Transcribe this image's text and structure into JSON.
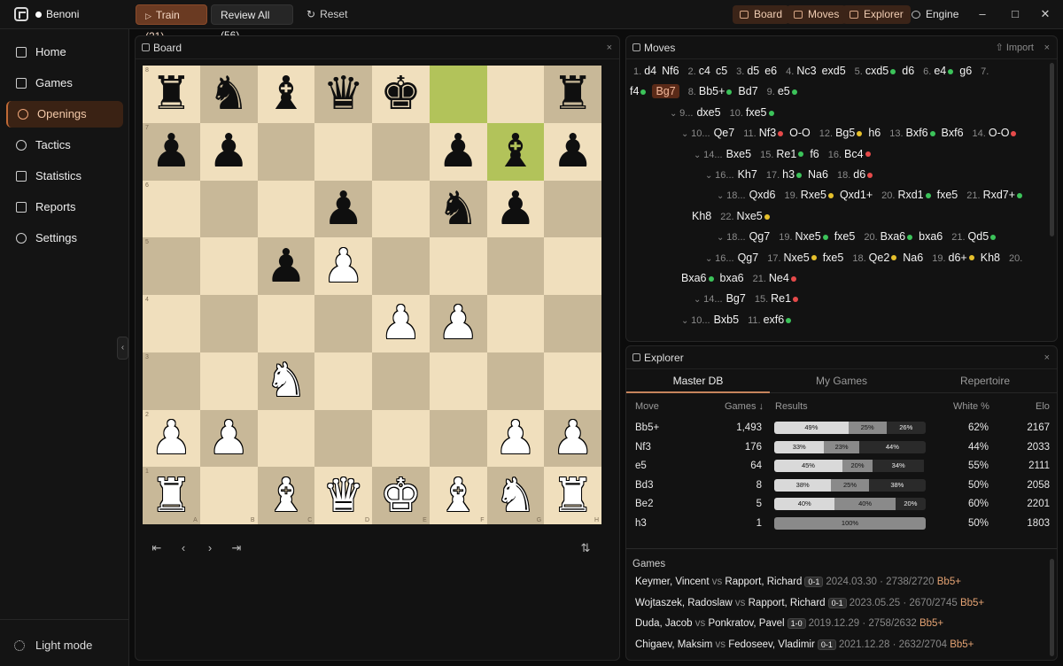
{
  "app": {
    "title": "Benoni"
  },
  "toolbar": {
    "train": "Train (21)",
    "review": "Review All (56)",
    "reset": "Reset"
  },
  "right_tabs": [
    "Board",
    "Moves",
    "Explorer",
    "Engine"
  ],
  "window_controls": [
    "minimize-icon",
    "maximize-icon",
    "close-icon"
  ],
  "sidebar": {
    "items": [
      {
        "label": "Home",
        "icon": "home-icon"
      },
      {
        "label": "Games",
        "icon": "library-icon"
      },
      {
        "label": "Openings",
        "icon": "openings-icon",
        "active": true
      },
      {
        "label": "Tactics",
        "icon": "target-icon"
      },
      {
        "label": "Statistics",
        "icon": "chart-icon"
      },
      {
        "label": "Reports",
        "icon": "report-icon"
      },
      {
        "label": "Settings",
        "icon": "gear-icon"
      }
    ],
    "light_mode": "Light mode"
  },
  "board_panel": {
    "title": "Board",
    "close": "×"
  },
  "board": {
    "files": [
      "A",
      "B",
      "C",
      "D",
      "E",
      "F",
      "G",
      "H"
    ],
    "ranks": [
      "8",
      "7",
      "6",
      "5",
      "4",
      "3",
      "2",
      "1"
    ],
    "highlight": [
      "f8",
      "g7"
    ],
    "pieces": [
      [
        "br",
        "bn",
        "bb",
        "bq",
        "bk",
        "",
        "",
        "br"
      ],
      [
        "bp",
        "bp",
        "",
        "",
        "",
        "bp",
        "bb",
        "bp"
      ],
      [
        "",
        "",
        "",
        "bp",
        "",
        "bn",
        "bp",
        ""
      ],
      [
        "",
        "",
        "bp",
        "wp",
        "",
        "",
        "",
        ""
      ],
      [
        "",
        "",
        "",
        "",
        "wp",
        "wp",
        "",
        ""
      ],
      [
        "",
        "",
        "wn",
        "",
        "",
        "",
        "",
        ""
      ],
      [
        "wp",
        "wp",
        "",
        "",
        "",
        "",
        "wp",
        "wp"
      ],
      [
        "wr",
        "",
        "wb",
        "wq",
        "wk",
        "wb",
        "wn",
        "wr"
      ]
    ]
  },
  "moves_panel": {
    "title": "Moves",
    "import": "Import",
    "lines": [
      {
        "indent": 0,
        "tokens": [
          [
            "1.",
            "n"
          ],
          [
            "d4",
            ""
          ],
          [
            "Nf6",
            ""
          ],
          [
            "2.",
            "n"
          ],
          [
            "c4",
            ""
          ],
          [
            "c5",
            ""
          ],
          [
            "3.",
            "n"
          ],
          [
            "d5",
            ""
          ],
          [
            "e6",
            ""
          ],
          [
            "4.",
            "n"
          ],
          [
            "Nc3",
            ""
          ],
          [
            "exd5",
            ""
          ],
          [
            "5.",
            "n"
          ],
          [
            "cxd5",
            "g"
          ],
          [
            "d6",
            ""
          ],
          [
            "6.",
            "n"
          ],
          [
            "e4",
            "g"
          ],
          [
            "g6",
            ""
          ],
          [
            "7.",
            "n"
          ]
        ]
      },
      {
        "indent": 0,
        "tokens": [
          [
            "f4",
            "g"
          ],
          [
            "Bg7",
            "cur"
          ],
          [
            "8.",
            "n"
          ],
          [
            "Bb5+",
            "g"
          ],
          [
            "Bd7",
            ""
          ],
          [
            "9.",
            "n"
          ],
          [
            "e5",
            "g"
          ]
        ]
      },
      {
        "indent": 1,
        "tokens": [
          [
            "9...",
            "v"
          ],
          [
            "dxe5",
            ""
          ],
          [
            "10.",
            "n"
          ],
          [
            "fxe5",
            "g"
          ]
        ]
      },
      {
        "indent": 2,
        "tokens": [
          [
            "10...",
            "v"
          ],
          [
            "Qe7",
            ""
          ],
          [
            "11.",
            "n"
          ],
          [
            "Nf3",
            "r"
          ],
          [
            "O-O",
            ""
          ],
          [
            "12.",
            "n"
          ],
          [
            "Bg5",
            "y"
          ],
          [
            "h6",
            ""
          ],
          [
            "13.",
            "n"
          ],
          [
            "Bxf6",
            "g"
          ],
          [
            "Bxf6",
            ""
          ],
          [
            "14.",
            "n"
          ],
          [
            "O-O",
            "r"
          ]
        ]
      },
      {
        "indent": 3,
        "tokens": [
          [
            "14...",
            "v"
          ],
          [
            "Bxe5",
            ""
          ],
          [
            "15.",
            "n"
          ],
          [
            "Re1",
            "g"
          ],
          [
            "f6",
            ""
          ],
          [
            "16.",
            "n"
          ],
          [
            "Bc4",
            "r"
          ]
        ]
      },
      {
        "indent": 4,
        "tokens": [
          [
            "16...",
            "v"
          ],
          [
            "Kh7",
            ""
          ],
          [
            "17.",
            "n"
          ],
          [
            "h3",
            "g"
          ],
          [
            "Na6",
            ""
          ],
          [
            "18.",
            "n"
          ],
          [
            "d6",
            "r"
          ]
        ]
      },
      {
        "indent": 5,
        "tokens": [
          [
            "18...",
            "v"
          ],
          [
            "Qxd6",
            ""
          ],
          [
            "19.",
            "n"
          ],
          [
            "Rxe5",
            "y"
          ],
          [
            "Qxd1+",
            ""
          ],
          [
            "20.",
            "n"
          ],
          [
            "Rxd1",
            "g"
          ],
          [
            "fxe5",
            ""
          ],
          [
            "21.",
            "n"
          ],
          [
            "Rxd7+",
            "g"
          ]
        ]
      },
      {
        "indent": 9,
        "tokens": [
          [
            "Kh8",
            ""
          ],
          [
            "22.",
            "n"
          ],
          [
            "Nxe5",
            "y"
          ]
        ]
      },
      {
        "indent": 5,
        "tokens": [
          [
            "18...",
            "v"
          ],
          [
            "Qg7",
            ""
          ],
          [
            "19.",
            "n"
          ],
          [
            "Nxe5",
            "g"
          ],
          [
            "fxe5",
            ""
          ],
          [
            "20.",
            "n"
          ],
          [
            "Bxa6",
            "g"
          ],
          [
            "bxa6",
            ""
          ],
          [
            "21.",
            "n"
          ],
          [
            "Qd5",
            "g"
          ]
        ]
      },
      {
        "indent": 4,
        "tokens": [
          [
            "16...",
            "v"
          ],
          [
            "Qg7",
            ""
          ],
          [
            "17.",
            "n"
          ],
          [
            "Nxe5",
            "y"
          ],
          [
            "fxe5",
            ""
          ],
          [
            "18.",
            "n"
          ],
          [
            "Qe2",
            "y"
          ],
          [
            "Na6",
            ""
          ],
          [
            "19.",
            "n"
          ],
          [
            "d6+",
            "y"
          ],
          [
            "Kh8",
            ""
          ],
          [
            "20.",
            "n"
          ]
        ]
      },
      {
        "indent": 10,
        "tokens": [
          [
            "Bxa6",
            "g"
          ],
          [
            "bxa6",
            ""
          ],
          [
            "21.",
            "n"
          ],
          [
            "Ne4",
            "r"
          ]
        ]
      },
      {
        "indent": 3,
        "tokens": [
          [
            "14...",
            "v"
          ],
          [
            "Bg7",
            ""
          ],
          [
            "15.",
            "n"
          ],
          [
            "Re1",
            "r"
          ]
        ]
      },
      {
        "indent": 2,
        "tokens": [
          [
            "10...",
            "v"
          ],
          [
            "Bxb5",
            ""
          ],
          [
            "11.",
            "n"
          ],
          [
            "exf6",
            "g"
          ]
        ]
      }
    ]
  },
  "explorer_panel": {
    "title": "Explorer",
    "tabs": [
      "Master DB",
      "My Games",
      "Repertoire"
    ],
    "headers": {
      "move": "Move",
      "games": "Games ↓",
      "results": "Results",
      "white": "White %",
      "elo": "Elo"
    },
    "rows": [
      {
        "move": "Bb5+",
        "games": "1,493",
        "w": 49,
        "d": 25,
        "b": 26,
        "wl": "49%",
        "dl": "25%",
        "bl": "26%",
        "white": "62%",
        "elo": "2167"
      },
      {
        "move": "Nf3",
        "games": "176",
        "w": 33,
        "d": 23,
        "b": 44,
        "wl": "33%",
        "dl": "23%",
        "bl": "44%",
        "white": "44%",
        "elo": "2033"
      },
      {
        "move": "e5",
        "games": "64",
        "w": 45,
        "d": 20,
        "b": 34,
        "wl": "45%",
        "dl": "20%",
        "bl": "34%",
        "white": "55%",
        "elo": "2111"
      },
      {
        "move": "Bd3",
        "games": "8",
        "w": 38,
        "d": 25,
        "b": 38,
        "wl": "38%",
        "dl": "25%",
        "bl": "38%",
        "white": "50%",
        "elo": "2058"
      },
      {
        "move": "Be2",
        "games": "5",
        "w": 40,
        "d": 40,
        "b": 20,
        "wl": "40%",
        "dl": "40%",
        "bl": "20%",
        "white": "60%",
        "elo": "2201"
      },
      {
        "move": "h3",
        "games": "1",
        "w": 0,
        "d": 100,
        "b": 0,
        "wl": "",
        "dl": "100%",
        "bl": "",
        "white": "50%",
        "elo": "1803"
      }
    ],
    "games_title": "Games",
    "games": [
      {
        "white": "Keymer, Vincent",
        "black": "Rapport, Richard",
        "result": "0-1",
        "date": "2024.03.30",
        "elo": "2738/2720",
        "move": "Bb5+"
      },
      {
        "white": "Wojtaszek, Radoslaw",
        "black": "Rapport, Richard",
        "result": "0-1",
        "date": "2023.05.25",
        "elo": "2670/2745",
        "move": "Bb5+"
      },
      {
        "white": "Duda, Jacob",
        "black": "Ponkratov, Pavel",
        "result": "1-0",
        "date": "2019.12.29",
        "elo": "2758/2632",
        "move": "Bb5+"
      },
      {
        "white": "Chigaev, Maksim",
        "black": "Fedoseev, Vladimir",
        "result": "0-1",
        "date": "2021.12.28",
        "elo": "2632/2704",
        "move": "Bb5+"
      }
    ]
  }
}
